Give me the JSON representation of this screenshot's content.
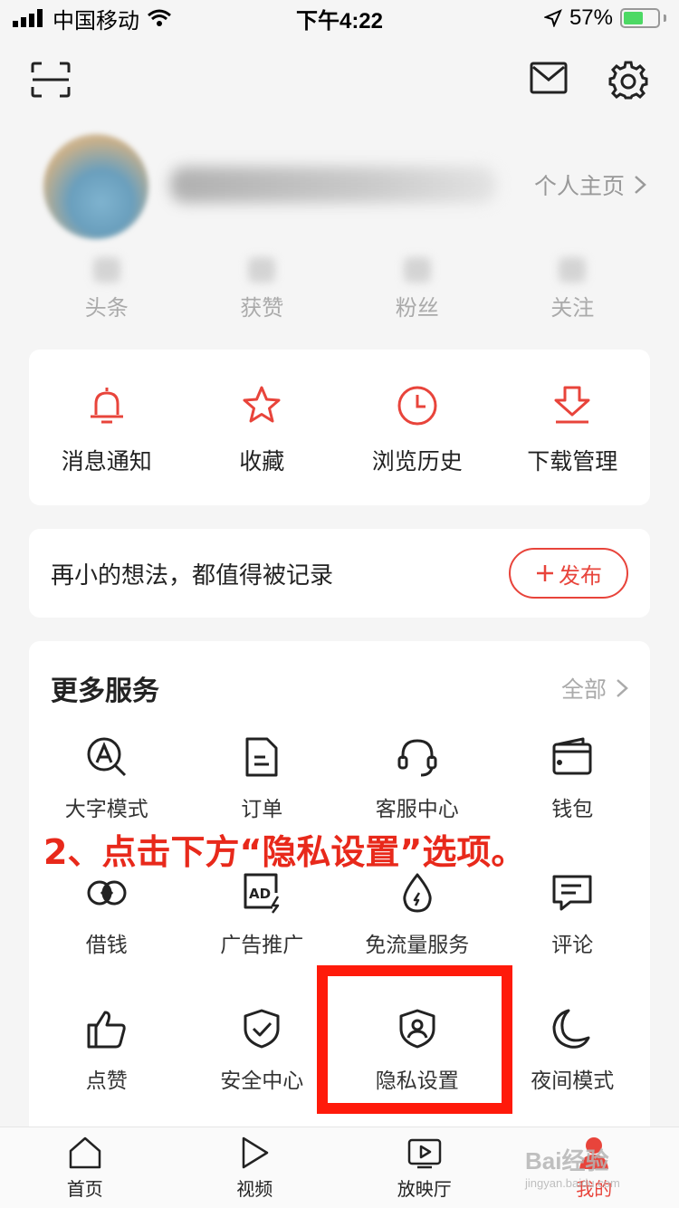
{
  "status_bar": {
    "carrier": "中国移动",
    "time": "下午4:22",
    "battery": "57%"
  },
  "profile": {
    "homepage_label": "个人主页"
  },
  "stats": [
    {
      "label": "头条"
    },
    {
      "label": "获赞"
    },
    {
      "label": "粉丝"
    },
    {
      "label": "关注"
    }
  ],
  "quick": [
    {
      "label": "消息通知",
      "icon": "bell-icon"
    },
    {
      "label": "收藏",
      "icon": "star-icon"
    },
    {
      "label": "浏览历史",
      "icon": "clock-icon"
    },
    {
      "label": "下载管理",
      "icon": "download-icon"
    }
  ],
  "post": {
    "prompt": "再小的想法，都值得被记录",
    "publish_label": "发布"
  },
  "services": {
    "title": "更多服务",
    "all_label": "全部",
    "items": [
      {
        "label": "大字模式",
        "icon": "large-font-icon"
      },
      {
        "label": "订单",
        "icon": "order-icon"
      },
      {
        "label": "客服中心",
        "icon": "headset-icon"
      },
      {
        "label": "钱包",
        "icon": "wallet-icon"
      },
      {
        "label": "借钱",
        "icon": "loan-icon"
      },
      {
        "label": "广告推广",
        "icon": "ad-icon"
      },
      {
        "label": "免流量服务",
        "icon": "data-free-icon"
      },
      {
        "label": "评论",
        "icon": "comment-icon"
      },
      {
        "label": "点赞",
        "icon": "thumbs-up-icon"
      },
      {
        "label": "安全中心",
        "icon": "security-shield-icon"
      },
      {
        "label": "隐私设置",
        "icon": "privacy-shield-icon"
      },
      {
        "label": "夜间模式",
        "icon": "moon-icon"
      }
    ]
  },
  "annotation": {
    "text": "2、点击下方“隐私设置”选项。",
    "color": "#e8291b"
  },
  "tabbar": [
    {
      "label": "首页",
      "icon": "home-icon"
    },
    {
      "label": "视频",
      "icon": "play-icon"
    },
    {
      "label": "放映厅",
      "icon": "tv-icon"
    },
    {
      "label": "我的",
      "icon": "profile-icon",
      "active": true
    }
  ],
  "watermark": {
    "main": "Bai经验",
    "sub": "jingyan.baidu.com"
  },
  "colors": {
    "accent": "#e8443b",
    "background": "#f5f5f5",
    "card": "#ffffff"
  }
}
